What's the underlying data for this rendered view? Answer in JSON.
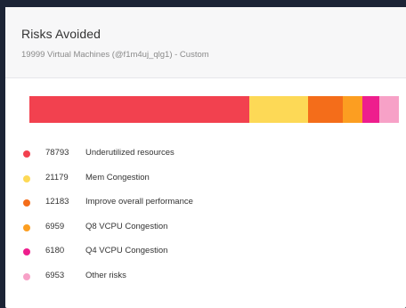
{
  "card": {
    "title": "Risks Avoided",
    "subtitle": "19999 Virtual Machines (@f1m4uj_qlg1) - Custom"
  },
  "risks": [
    {
      "value": "78793",
      "label": "Underutilized resources",
      "color": "#f2414f",
      "share": 0.59
    },
    {
      "value": "21179",
      "label": "Mem Congestion",
      "color": "#fdd956",
      "share": 0.16
    },
    {
      "value": "12183",
      "label": "Improve overall performance",
      "color": "#f46d1a",
      "share": 0.092
    },
    {
      "value": "6959",
      "label": "Q8 VCPU Congestion",
      "color": "#fc9e21",
      "share": 0.052
    },
    {
      "value": "6180",
      "label": "Q4 VCPU Congestion",
      "color": "#ee1e8d",
      "share": 0.047
    },
    {
      "value": "6953",
      "label": "Other risks",
      "color": "#f7a1c7",
      "share": 0.052
    }
  ]
}
